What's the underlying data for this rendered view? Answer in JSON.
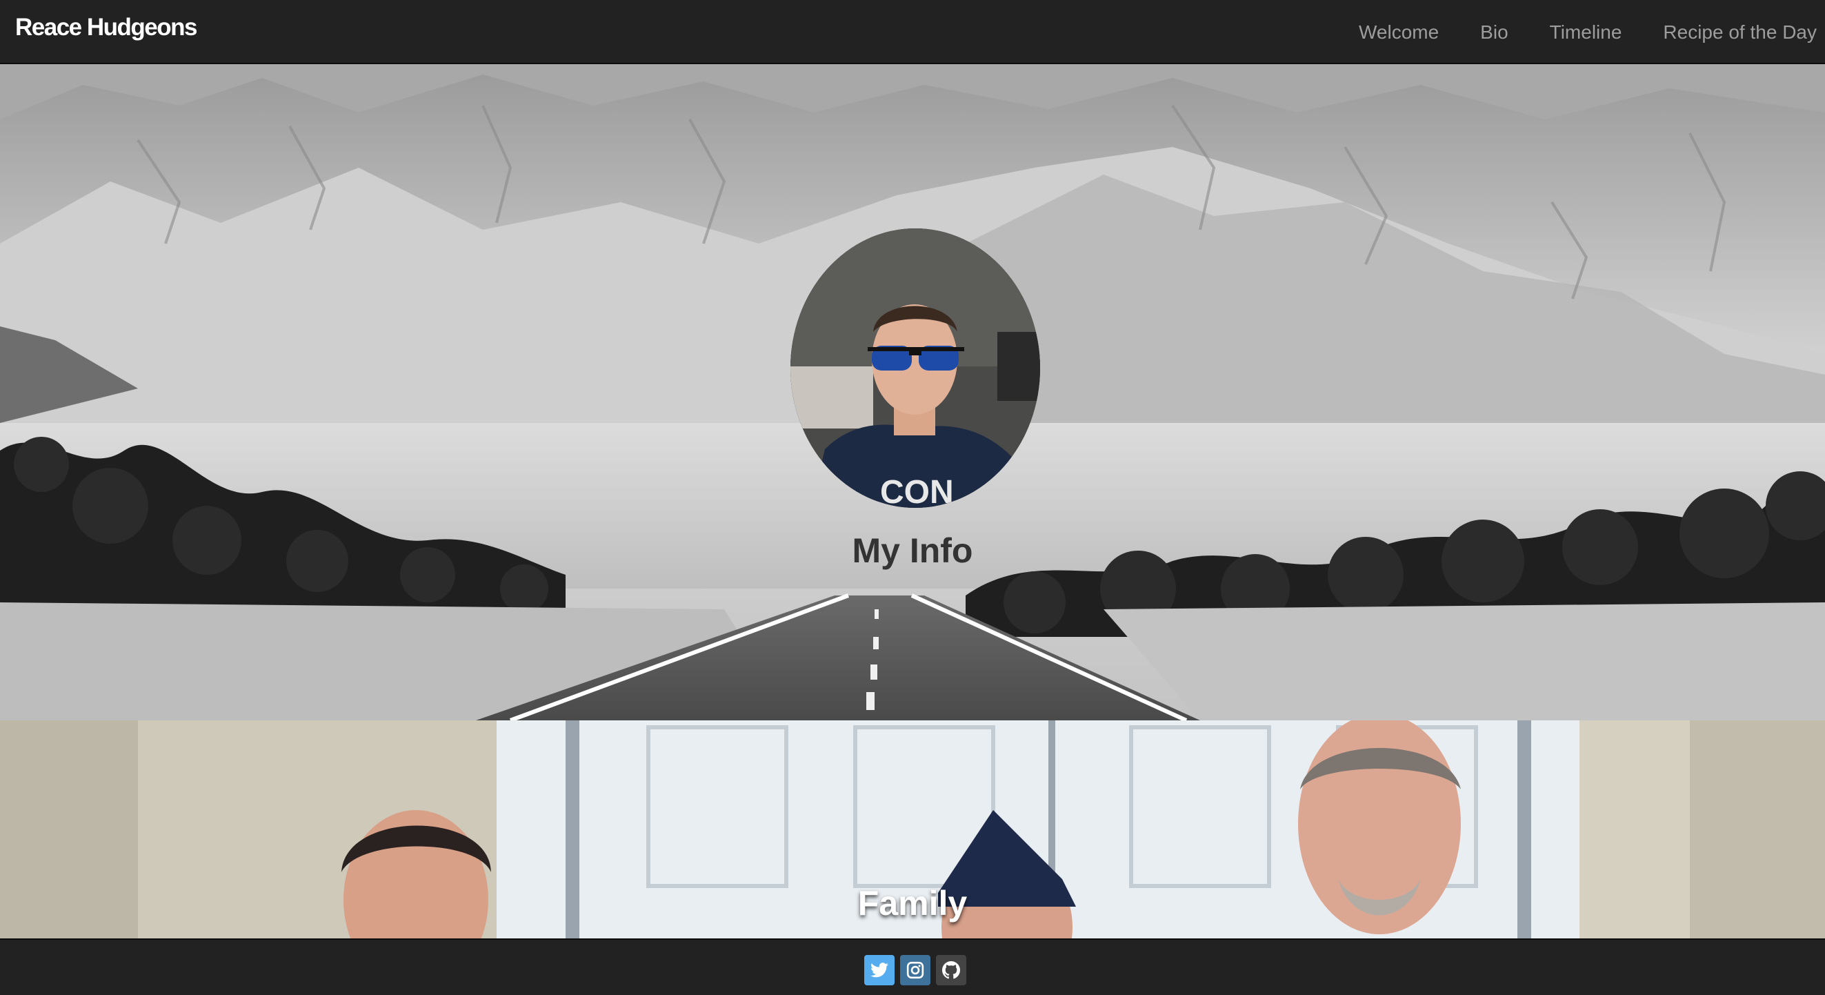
{
  "navbar": {
    "brand": "Reace Hudgeons",
    "links": [
      {
        "label": "Welcome"
      },
      {
        "label": "Bio"
      },
      {
        "label": "Timeline"
      },
      {
        "label": "Recipe of the Day"
      }
    ]
  },
  "hero": {
    "title": "My Info",
    "avatar_image": "profile-photo-selfie-sunglasses",
    "background_image": "black-and-white-desert-road-mountains"
  },
  "family": {
    "title": "Family",
    "background_image": "family-photo-three-men-white-doors"
  },
  "footer": {
    "social": [
      {
        "name": "twitter",
        "icon": "twitter-icon",
        "color": "#55acee"
      },
      {
        "name": "instagram",
        "icon": "instagram-icon",
        "color": "#3f729b"
      },
      {
        "name": "github",
        "icon": "github-icon",
        "color": "#444444"
      }
    ]
  },
  "colors": {
    "navbar_bg": "#222222",
    "nav_link": "#9d9d9d",
    "brand": "#ffffff",
    "hero_title": "#333333",
    "family_title": "#ffffff"
  }
}
